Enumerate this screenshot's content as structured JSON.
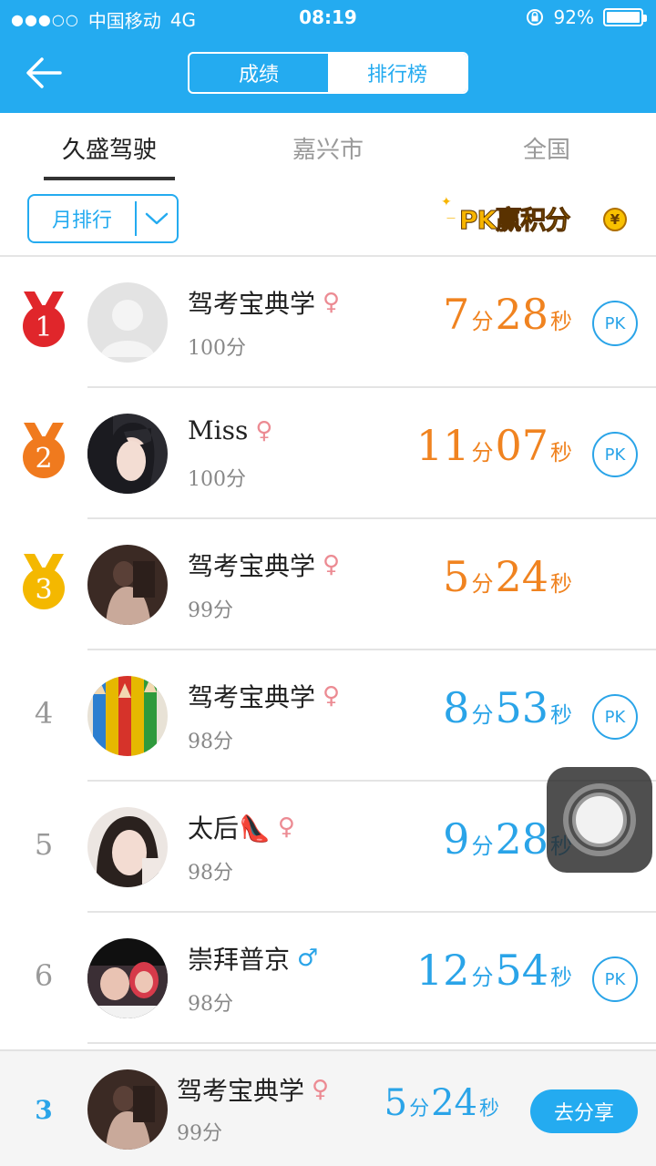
{
  "status_bar": {
    "signal": "●●●○○",
    "carrier": "中国移动",
    "network": "4G",
    "time": "08:19",
    "battery": "92%",
    "battery_level": 0.92
  },
  "header": {
    "segments": [
      "成绩",
      "排行榜"
    ],
    "selected_segment": "排行榜"
  },
  "region_tabs": [
    "久盛驾驶",
    "嘉兴市",
    "全国"
  ],
  "active_region": "久盛驾驶",
  "filter": {
    "label": "月排行"
  },
  "promo": {
    "label": "PK赢积分",
    "coin": "¥"
  },
  "time_units": {
    "min": "分",
    "sec": "秒"
  },
  "pk_label": "PK",
  "ranking": [
    {
      "rank": "1",
      "medal": "gold-red",
      "name": "驾考宝典学",
      "gender": "♀",
      "score": "100分",
      "minutes": "7",
      "seconds": "28",
      "color": "#f08320",
      "pk": true,
      "avatar": "default-avatar"
    },
    {
      "rank": "2",
      "medal": "orange",
      "name": "Miss",
      "gender": "♀",
      "score": "100分",
      "minutes": "11",
      "seconds": "07",
      "color": "#f08320",
      "pk": true,
      "avatar": "woman-dark-hair"
    },
    {
      "rank": "3",
      "medal": "yellow",
      "name": "驾考宝典学",
      "gender": "♀",
      "score": "99分",
      "minutes": "5",
      "seconds": "24",
      "color": "#f08320",
      "pk": false,
      "avatar": "sitting-figure"
    },
    {
      "rank": "4",
      "name": "驾考宝典学",
      "gender": "♀",
      "score": "98分",
      "minutes": "8",
      "seconds": "53",
      "color": "#2aa4e8",
      "pk": true,
      "avatar": "colored-pencils"
    },
    {
      "rank": "5",
      "name": "太后👠",
      "gender": "♀",
      "score": "98分",
      "minutes": "9",
      "seconds": "28",
      "color": "#2aa4e8",
      "pk": false,
      "avatar": "woman-portrait"
    },
    {
      "rank": "6",
      "name": "崇拜普京",
      "gender": "♂",
      "score": "98分",
      "minutes": "12",
      "seconds": "54",
      "color": "#2aa4e8",
      "pk": true,
      "avatar": "child-photo"
    }
  ],
  "my_rank": {
    "rank": "3",
    "name": "驾考宝典学",
    "gender": "♀",
    "score": "99分",
    "minutes": "5",
    "seconds": "24",
    "share_label": "去分享"
  }
}
